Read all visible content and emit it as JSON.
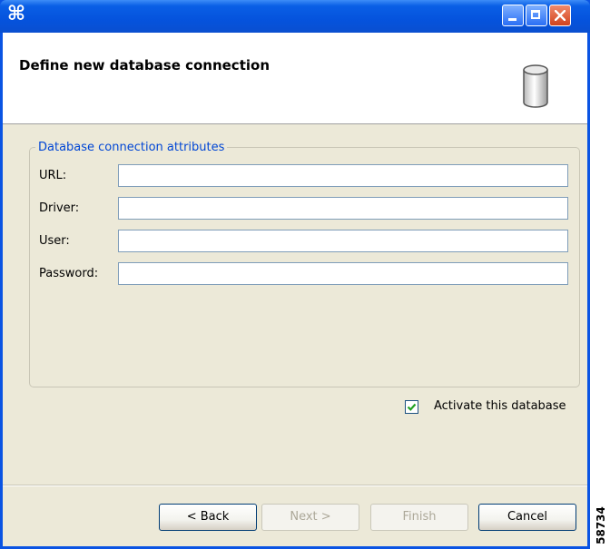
{
  "window": {
    "app_icon": "⌘",
    "controls": {
      "minimize": "minimize-icon",
      "maximize": "maximize-icon",
      "close": "close-icon"
    }
  },
  "header": {
    "title": "Define new database connection",
    "icon": "database-icon"
  },
  "group": {
    "legend": "Database connection attributes",
    "fields": [
      {
        "label": "URL:",
        "value": ""
      },
      {
        "label": "Driver:",
        "value": ""
      },
      {
        "label": "User:",
        "value": ""
      },
      {
        "label": "Password:",
        "value": ""
      }
    ]
  },
  "activate": {
    "label": "Activate this database",
    "checked": true
  },
  "buttons": {
    "back": "< Back",
    "next": "Next >",
    "finish": "Finish",
    "cancel": "Cancel"
  },
  "figure_id": "58734"
}
